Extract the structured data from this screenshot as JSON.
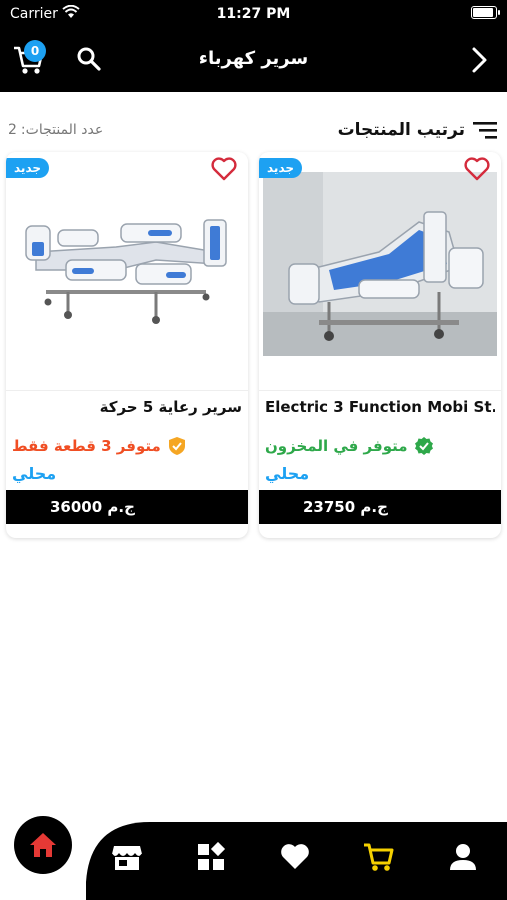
{
  "status_bar": {
    "carrier": "Carrier",
    "time": "11:27 PM"
  },
  "nav": {
    "title": "سرير كهرباء",
    "cart_count": "0"
  },
  "toolbar": {
    "sort_label": "ترتيب المنتجات",
    "count_label": "عدد المنتجات:",
    "count_value": "2"
  },
  "products": [
    {
      "name": "سرير رعاية 5 حركة",
      "badge": "جديد",
      "stock_text": "متوفر 3 قطعة فقط",
      "stock_color": "#f04e23",
      "location": "محلي",
      "price": "36000 ج.م"
    },
    {
      "name": "Electric 3 Function Mobi St...",
      "badge": "جديد",
      "stock_text": "متوفر في المخزون",
      "stock_color": "#2ea84a",
      "location": "محلي",
      "price": "23750 ج.م"
    }
  ],
  "colors": {
    "accent": "#1da1f2",
    "home": "#e53935",
    "cart_tab": "#f5d000"
  },
  "tabs": [
    "home-icon",
    "store-icon",
    "categories-icon",
    "favorites-icon",
    "cart-icon",
    "profile-icon"
  ]
}
